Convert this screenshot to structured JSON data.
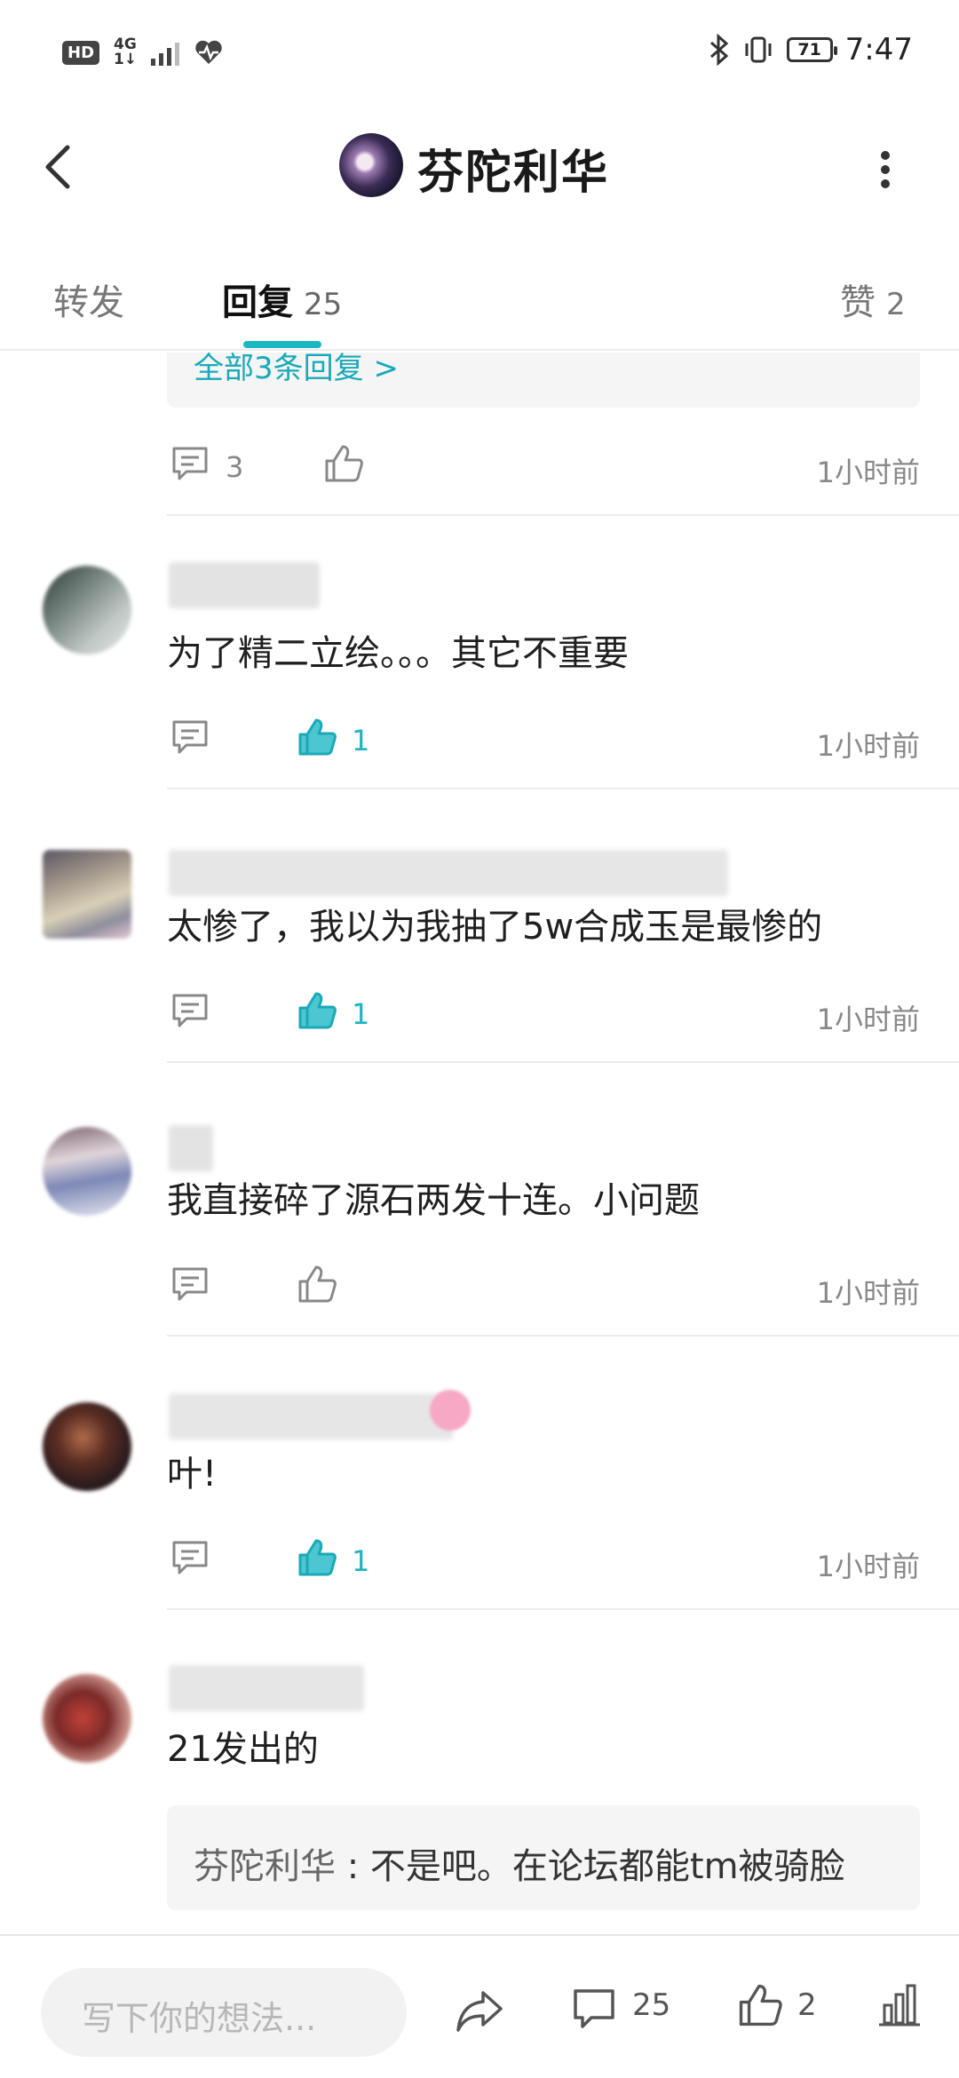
{
  "status_bar": {
    "hd": "HD",
    "network": "4G",
    "network_sub": "1↓",
    "battery": "71",
    "time": "7:47"
  },
  "header": {
    "title": "芬陀利华"
  },
  "tabs": {
    "forward": "转发",
    "reply": "回复",
    "reply_count": "25",
    "like": "赞",
    "like_count": "2"
  },
  "thread": {
    "all_replies_link": "全部3条回复 >",
    "first_actions": {
      "comment_count": "3",
      "time": "1小时前"
    },
    "comments": [
      {
        "text": "为了精二立绘。。。其它不重要",
        "likes": "1",
        "liked": true,
        "time": "1小时前"
      },
      {
        "text": "太惨了，我以为我抽了5w合成玉是最惨的",
        "likes": "1",
        "liked": true,
        "time": "1小时前"
      },
      {
        "text": "我直接碎了源石两发十连。小问题",
        "likes": "",
        "liked": false,
        "time": "1小时前"
      },
      {
        "text": "叶!",
        "likes": "1",
        "liked": true,
        "time": "1小时前"
      },
      {
        "text": "21发出的"
      }
    ],
    "quote": {
      "name": "芬陀利华",
      "sep": " : ",
      "text": "不是吧。在论坛都能tm被骑脸"
    }
  },
  "bottom_bar": {
    "placeholder": "写下你的想法...",
    "comment_count": "25",
    "like_count": "2"
  },
  "colors": {
    "accent": "#19b6c4",
    "text": "#1f1f1f",
    "muted": "#888888"
  }
}
